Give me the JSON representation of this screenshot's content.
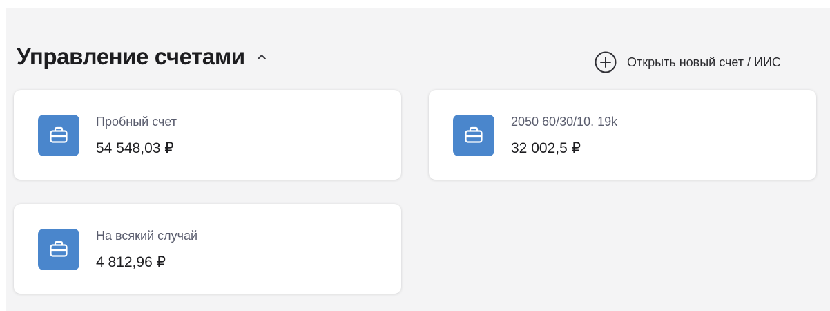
{
  "header": {
    "title": "Управление счетами",
    "open_account_label": "Открыть новый счет / ИИС"
  },
  "accounts": [
    {
      "name": "Пробный счет",
      "balance": "54 548,03 ₽",
      "icon": "briefcase-icon"
    },
    {
      "name": "2050 60/30/10. 19k",
      "balance": "32 002,5 ₽",
      "icon": "briefcase-icon"
    },
    {
      "name": "На всякий случай",
      "balance": "4 812,96 ₽",
      "icon": "briefcase-icon"
    }
  ],
  "colors": {
    "background": "#f4f4f5",
    "card": "#ffffff",
    "icon_tile": "#4a86cc",
    "title_text": "#1d1d20",
    "secondary_text": "#5a5d6e"
  }
}
